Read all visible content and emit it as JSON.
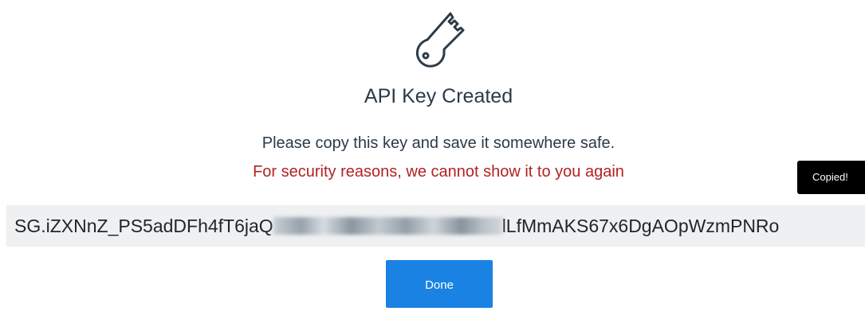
{
  "modal": {
    "icon": "key-icon",
    "title": "API Key Created",
    "instruction": "Please copy this key and save it somewhere safe.",
    "warning": "For security reasons, we cannot show it to you again",
    "tooltip": "Copied!",
    "api_key": {
      "prefix": "SG.iZXNnZ_PS5adDFh4fT6jaQ",
      "suffix": "lLfMmAKS67x6DgAOpWzmPNRo"
    },
    "done_label": "Done"
  },
  "colors": {
    "brand_blue": "#1a82e2",
    "warning_red": "#b22222",
    "text_dark": "#2c3a48",
    "key_box_bg": "#eef0f2",
    "tooltip_bg": "#000000"
  }
}
